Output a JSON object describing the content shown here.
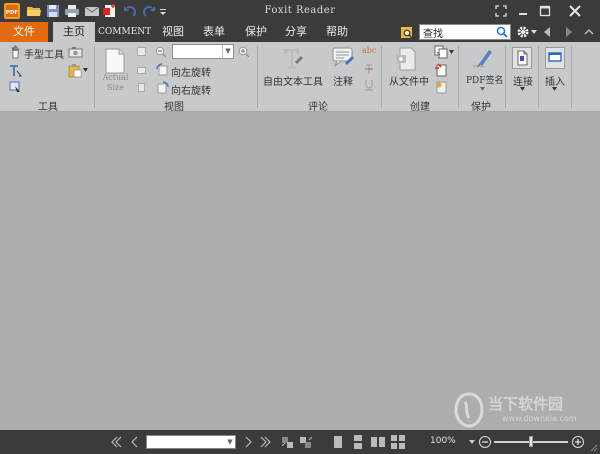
{
  "window": {
    "title": "Foxit Reader",
    "app_logo_text": "PDF"
  },
  "menu": {
    "tabs": [
      {
        "label": "文件"
      },
      {
        "label": "主页"
      },
      {
        "label": "COMMENT"
      },
      {
        "label": "视图"
      },
      {
        "label": "表单"
      },
      {
        "label": "保护"
      },
      {
        "label": "分享"
      },
      {
        "label": "帮助"
      }
    ],
    "search_value": "查找"
  },
  "ribbon": {
    "tools": {
      "hand_label": "手型工具",
      "group_label": "工具"
    },
    "view": {
      "actual_size_label_1": "Actual",
      "actual_size_label_2": "Size",
      "rotate_left_label": "向左旋转",
      "rotate_right_label": "向右旋转",
      "zoom_value": "",
      "group_label": "视图"
    },
    "comment": {
      "textbox_label": "自由文本工具",
      "note_label": "注释",
      "abc_label": "abc",
      "group_label": "评论"
    },
    "create": {
      "from_file_label": "从文件中",
      "group_label": "创建"
    },
    "protect": {
      "sign_label": "PDF签名",
      "group_label": "保护"
    },
    "link_label": "连接",
    "insert_label": "插入"
  },
  "statusbar": {
    "page_value": "",
    "zoom_percent": "100%",
    "zoom_slider_fraction": 0.5
  },
  "watermark": {
    "brand": "当下软件园",
    "url": "www.downxia.com"
  },
  "colors": {
    "accent": "#e36a10",
    "chrome": "#3b3b3b",
    "ribbon": "#c7c9cb",
    "document_bg": "#adadad"
  }
}
